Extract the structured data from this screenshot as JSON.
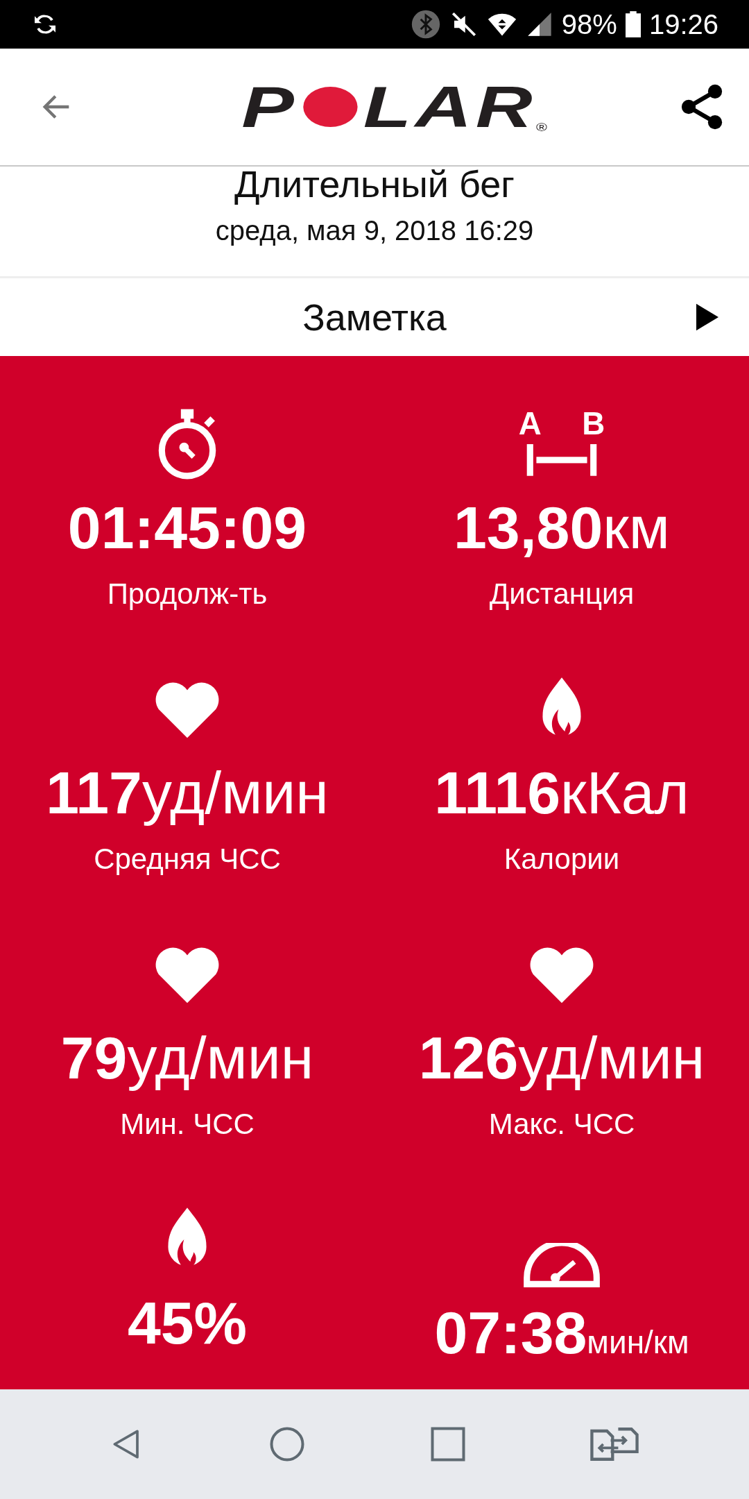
{
  "status_bar": {
    "battery": "98%",
    "time": "19:26"
  },
  "header": {
    "logo": [
      "P",
      "LAR"
    ],
    "logo_mark": "®"
  },
  "session": {
    "title": "Длительный бег",
    "date": "среда, мая 9, 2018 16:29"
  },
  "note": {
    "label": "Заметка"
  },
  "distance_icon": {
    "letters": [
      "A",
      "B"
    ]
  },
  "stats": [
    {
      "kind": "duration",
      "value": "01:45:09",
      "label": "Продолж-ть"
    },
    {
      "kind": "distance",
      "value": "13,80",
      "unit": "км",
      "label": "Дистанция"
    },
    {
      "kind": "heart",
      "value": "117",
      "unit": "уд/мин",
      "label": "Средняя ЧСС"
    },
    {
      "kind": "flame",
      "value": "1116",
      "unit": "кКал",
      "label": "Калории"
    },
    {
      "kind": "heart",
      "value": "79",
      "unit": "уд/мин",
      "label": "Мин. ЧСС"
    },
    {
      "kind": "heart",
      "value": "126",
      "unit": "уд/мин",
      "label": "Макс. ЧСС"
    },
    {
      "kind": "flame",
      "value": "45%"
    },
    {
      "kind": "pace",
      "value": "07:38",
      "unit": "мин/км"
    }
  ]
}
